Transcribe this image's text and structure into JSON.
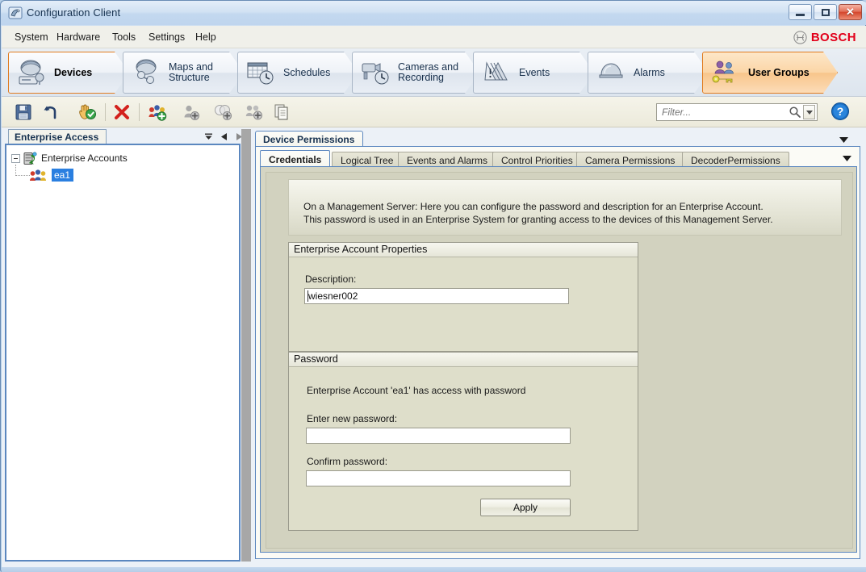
{
  "window": {
    "title": "Configuration Client",
    "title_icon": "app-icon",
    "minimize": "–",
    "maximize": "□",
    "close": "✕"
  },
  "menubar": {
    "items": [
      {
        "label": "System"
      },
      {
        "label": "Hardware"
      },
      {
        "label": "Tools"
      },
      {
        "label": "Settings"
      },
      {
        "label": "Help"
      }
    ],
    "brand": "BOSCH"
  },
  "ribbon": {
    "tabs": [
      {
        "label": "Devices",
        "icon": "device-camera-server-icon",
        "active": true
      },
      {
        "label": "Maps and\nStructure",
        "icon": "maps-structure-icon",
        "active": false
      },
      {
        "label": "Schedules",
        "icon": "schedule-clock-icon",
        "active": false
      },
      {
        "label": "Cameras and\nRecording",
        "icon": "camera-recording-icon",
        "active": false
      },
      {
        "label": "Events",
        "icon": "events-warning-icon",
        "active": false
      },
      {
        "label": "Alarms",
        "icon": "alarms-bell-icon",
        "active": false
      },
      {
        "label": "User Groups",
        "icon": "user-groups-key-icon",
        "active": true
      }
    ]
  },
  "toolbar": {
    "buttons": [
      {
        "name": "save-button",
        "icon": "floppy-save-icon"
      },
      {
        "name": "undo-button",
        "icon": "undo-arrow-icon"
      },
      {
        "name": "activate-button",
        "icon": "hand-activate-icon"
      },
      {
        "name": "delete-button",
        "icon": "red-x-delete-icon"
      },
      {
        "name": "new-user-group-button",
        "icon": "add-user-group-icon"
      },
      {
        "name": "new-user-button",
        "icon": "add-user-icon"
      },
      {
        "name": "new-dual-authorization-button",
        "icon": "add-dual-auth-icon"
      },
      {
        "name": "new-enterprise-user-group-button",
        "icon": "add-enterprise-user-group-icon"
      },
      {
        "name": "copy-button",
        "icon": "copy-pages-icon"
      }
    ],
    "filter_placeholder": "Filter...",
    "filter_value": "",
    "help_icon": "help-question-icon"
  },
  "left_panel": {
    "tab_label": "Enterprise Access",
    "dock_buttons": [
      {
        "name": "dock-menu-button",
        "glyph": "▼"
      },
      {
        "name": "dock-prev-button",
        "glyph": "◀"
      },
      {
        "name": "dock-next-button",
        "glyph": "▶"
      }
    ],
    "tree": [
      {
        "label": "Enterprise Accounts",
        "icon": "enterprise-accounts-server-icon",
        "level": 0,
        "expanded": true,
        "selected": false
      },
      {
        "label": "ea1",
        "icon": "enterprise-account-users-icon",
        "level": 1,
        "expanded": false,
        "selected": true
      }
    ]
  },
  "right_panel": {
    "dock_tab": "Device Permissions",
    "collapse_glyph": "▼",
    "tabs": [
      {
        "label": "Credentials",
        "active": true
      },
      {
        "label": "Logical Tree",
        "active": false
      },
      {
        "label": "Events and Alarms",
        "active": false
      },
      {
        "label": "Control Priorities",
        "active": false
      },
      {
        "label": "Camera Permissions",
        "active": false
      },
      {
        "label": "DecoderPermissions",
        "active": false
      }
    ],
    "tabs_overflow_glyph": "▼",
    "info": {
      "line1": "On a Management Server: Here you can configure the password and description for an Enterprise Account.",
      "line2": "This password is used in an Enterprise System for granting access to the devices of this Management Server."
    },
    "account_properties": {
      "title": "Enterprise Account Properties",
      "description_label": "Description:",
      "description_value": "wiesner002",
      "description_placeholder": ""
    },
    "password": {
      "title": "Password",
      "status_text": "Enterprise Account 'ea1' has access with password",
      "new_password_label": "Enter new password:",
      "new_password_value": "",
      "confirm_password_label": "Confirm password:",
      "confirm_password_value": "",
      "apply_label": "Apply"
    }
  },
  "colors": {
    "accent_orange": "#e07b1f",
    "brand_red": "#e2001a",
    "tab_blue": "#5b87bf",
    "panel_beige": "#d2d2bf",
    "selection_blue": "#2a7fe0"
  }
}
